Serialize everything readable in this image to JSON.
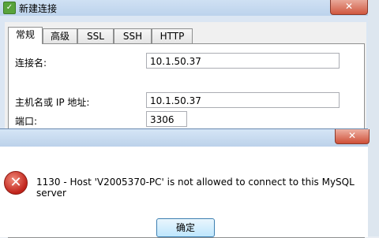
{
  "window": {
    "title": "新建连接",
    "tabs": [
      {
        "label": "常规"
      },
      {
        "label": "高级"
      },
      {
        "label": "SSL"
      },
      {
        "label": "SSH"
      },
      {
        "label": "HTTP"
      }
    ],
    "form": {
      "connection_name_label": "连接名:",
      "connection_name_value": "10.1.50.37",
      "host_label": "主机名或 IP 地址:",
      "host_value": "10.1.50.37",
      "port_label": "端口:",
      "port_value": "3306"
    }
  },
  "dialog": {
    "message": "1130 - Host 'V2005370-PC' is not allowed to connect to this MySQL server",
    "ok_label": "确定"
  },
  "icons": {
    "app": "navicat-app-icon",
    "error": "error-icon",
    "close": "close-icon"
  }
}
